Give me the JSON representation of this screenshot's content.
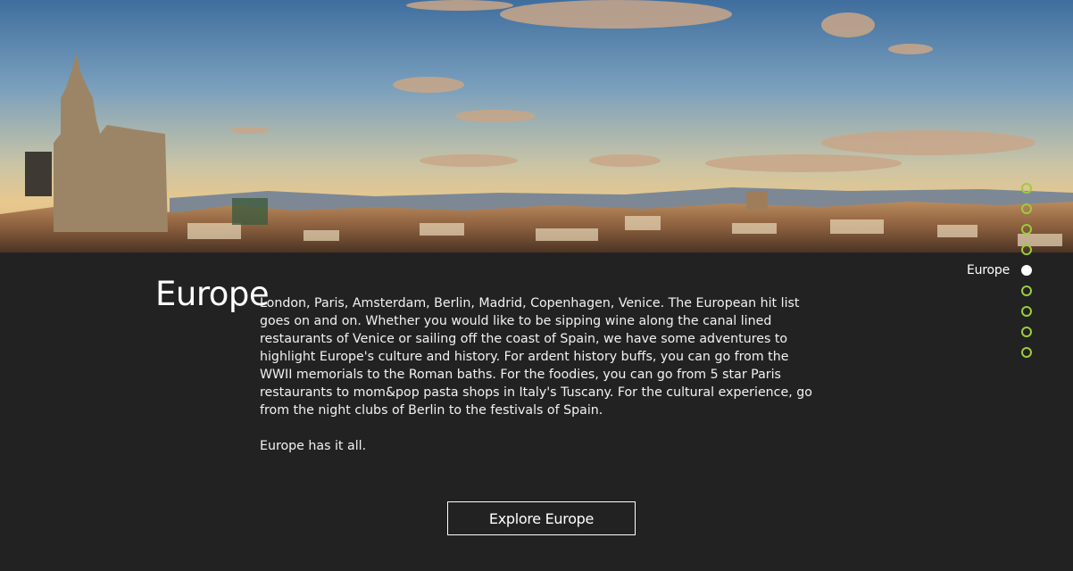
{
  "hero": {
    "image": "Madrid city skyline at sunset with blue sky, clouds and distant mountains"
  },
  "section": {
    "title": "Europe",
    "paragraphs": [
      "London, Paris, Amsterdam, Berlin, Madrid, Copenhagen, Venice. The European hit list goes on and on. Whether you would like to be sipping wine along the canal lined restaurants of Venice or sailing off the coast of Spain, we have some adventures to highlight Europe's culture and history. For ardent history buffs, you can go from the WWII memorials to the Roman baths. For the foodies, you can go from 5 star Paris restaurants to mom&pop pasta shops in Italy's Tuscany. For the cultural experience, go from the night clubs of Berlin to the festivals of Spain.",
      "Europe has it all."
    ],
    "button_label": "Explore Europe"
  },
  "anchor_nav": {
    "items": [
      {
        "label": "",
        "active": false
      },
      {
        "label": "",
        "active": false
      },
      {
        "label": "",
        "active": false
      },
      {
        "label": "",
        "active": false
      },
      {
        "label": "Europe",
        "active": true
      },
      {
        "label": "",
        "active": false
      },
      {
        "label": "",
        "active": false
      },
      {
        "label": "",
        "active": false
      },
      {
        "label": "",
        "active": false
      }
    ],
    "dot_color": "#9ccc3c",
    "active_color": "#ffffff"
  },
  "colors": {
    "background": "#222222",
    "text": "#ffffff"
  }
}
